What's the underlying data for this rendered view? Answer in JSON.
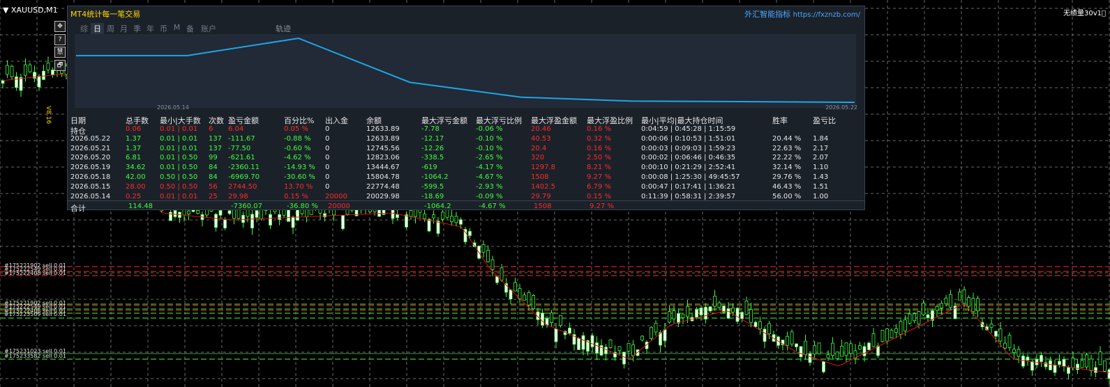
{
  "chart": {
    "symbol": "XAUUSD,M1",
    "right_label": "无绩量30v1⃝",
    "side_text": "V8.16",
    "order_labels": [
      "#175221902 sell 0.01",
      "#175222549 sell 0.01",
      "#175222408 sell 0.01",
      "#175221902 sell 0.01",
      "#175222549 sell 0.01",
      "#175222408 sell 0.01",
      "#175223509 sell 0.01",
      "#175231023 sell 0.01",
      "#175233582 sell 0.01"
    ]
  },
  "toolbar": {
    "icons": [
      "move-icon",
      "help-icon",
      "ai-icon",
      "window-icon"
    ],
    "glyphs": [
      "✥",
      "?",
      "慧",
      "🗗"
    ]
  },
  "panel": {
    "title": "MT4统计每一笔交易",
    "brand": "外汇智能指标",
    "brand_url": "https://fxznzb.com/",
    "tabs": [
      "综",
      "日",
      "周",
      "月",
      "季",
      "年",
      "币",
      "M",
      "备",
      "账户"
    ],
    "active_tab": 1,
    "track_tab": "轨迹",
    "plot": {
      "start_date": "2026.05.14",
      "end_date": "2026.05.22",
      "line_color": "#1fa5e8",
      "balance_series": [
        20029.98,
        20029.98,
        22774.48,
        15804.78,
        13444.67,
        12823.06,
        12745.56,
        12633.89
      ]
    },
    "headers": [
      "日期",
      "总手数",
      "最小|大手数",
      "次数",
      "盈亏金额",
      "百分比%",
      "出入金",
      "余额",
      "最大浮亏金额",
      "最大浮亏比例",
      "最大浮盈金额",
      "最大浮盈比例",
      "最小|平均|最大持仓时间",
      "胜率",
      "盈亏比"
    ],
    "rows": [
      {
        "c": [
          "持仓",
          "0.06",
          "0.01 | 0.01",
          "6",
          "6.04",
          "0.05 %",
          "0",
          "12633.89",
          "-7.78",
          "-0.06 %",
          "20.46",
          "0.16 %",
          "0:04:59 | 0:45:28 | 1:15:59",
          "",
          ""
        ],
        "k": [
          "w",
          "r",
          "r",
          "r",
          "r",
          "r",
          "w",
          "w",
          "g",
          "g",
          "r",
          "r",
          "w",
          "w",
          "w"
        ]
      },
      {
        "c": [
          "2026.05.22",
          "1.37",
          "0.01 | 0.01",
          "137",
          "-111.67",
          "-0.88 %",
          "0",
          "12633.89",
          "-12.17",
          "-0.10 %",
          "40.53",
          "0.32 %",
          "0:00:06 | 0:10:53 | 1:51:01",
          "20.44 %",
          "1.84"
        ],
        "k": [
          "w",
          "g",
          "g",
          "g",
          "g",
          "g",
          "w",
          "w",
          "g",
          "g",
          "r",
          "r",
          "w",
          "w",
          "w"
        ]
      },
      {
        "c": [
          "2026.05.21",
          "1.37",
          "0.01 | 0.01",
          "137",
          "-77.50",
          "-0.60 %",
          "0",
          "12745.56",
          "-12.26",
          "-0.10 %",
          "20.4",
          "0.16 %",
          "0:00:03 | 0:09:03 | 1:59:23",
          "22.63 %",
          "2.17"
        ],
        "k": [
          "w",
          "g",
          "g",
          "g",
          "g",
          "g",
          "w",
          "w",
          "g",
          "g",
          "r",
          "r",
          "w",
          "w",
          "w"
        ]
      },
      {
        "c": [
          "2026.05.20",
          "6.81",
          "0.01 | 0.50",
          "99",
          "-621.61",
          "-4.62 %",
          "0",
          "12823.06",
          "-338.5",
          "-2.65 %",
          "320",
          "2.50 %",
          "0:00:02 | 0:06:46 | 0:46:35",
          "22.22 %",
          "2.07"
        ],
        "k": [
          "w",
          "g",
          "g",
          "g",
          "g",
          "g",
          "w",
          "w",
          "g",
          "g",
          "r",
          "r",
          "w",
          "w",
          "w"
        ]
      },
      {
        "c": [
          "2026.05.19",
          "34.62",
          "0.01 | 0.50",
          "84",
          "-2360.11",
          "-14.93 %",
          "0",
          "13444.67",
          "-619",
          "-4.17 %",
          "1297.8",
          "8.21 %",
          "0:00:10 | 0:21:29 | 2:52:41",
          "32.14 %",
          "1.10"
        ],
        "k": [
          "w",
          "g",
          "g",
          "g",
          "g",
          "g",
          "w",
          "w",
          "g",
          "g",
          "r",
          "r",
          "w",
          "w",
          "w"
        ]
      },
      {
        "c": [
          "2026.05.18",
          "42.00",
          "0.50 | 0.50",
          "84",
          "-6969.70",
          "-30.60 %",
          "0",
          "15804.78",
          "-1064.2",
          "-4.67 %",
          "1508",
          "9.27 %",
          "0:00:08 | 1:25:30 | 49:45:57",
          "29.76 %",
          "1.43"
        ],
        "k": [
          "w",
          "g",
          "g",
          "g",
          "g",
          "g",
          "w",
          "w",
          "g",
          "g",
          "r",
          "r",
          "w",
          "w",
          "w"
        ]
      },
      {
        "c": [
          "2026.05.15",
          "28.00",
          "0.50 | 0.50",
          "56",
          "2744.50",
          "13.70 %",
          "0",
          "22774.48",
          "-599.5",
          "-2.93 %",
          "1402.5",
          "6.79 %",
          "0:00:47 | 0:17:41 | 1:36:21",
          "46.43 %",
          "1.51"
        ],
        "k": [
          "w",
          "r",
          "r",
          "r",
          "r",
          "r",
          "w",
          "w",
          "g",
          "g",
          "r",
          "r",
          "w",
          "w",
          "w"
        ]
      },
      {
        "c": [
          "2026.05.14",
          "0.25",
          "0.01 | 0.01",
          "25",
          "29.98",
          "0.15 %",
          "20000",
          "20029.98",
          "-18.69",
          "-0.09 %",
          "29.79",
          "0.15 %",
          "0:11:39 | 0:58:31 | 2:39:57",
          "56.00 %",
          "1.00"
        ],
        "k": [
          "w",
          "r",
          "r",
          "r",
          "r",
          "r",
          "r",
          "w",
          "g",
          "g",
          "r",
          "r",
          "w",
          "w",
          "w"
        ]
      }
    ],
    "total": {
      "label": "合计",
      "lots": "114.48",
      "pnl": "-7360.07",
      "pct": "-36.80 %",
      "deposit": "20000",
      "max_float_loss": "-1064.2",
      "max_float_loss_pct": "-4.67 %",
      "max_float_profit": "1508",
      "max_float_profit_pct": "9.27 %"
    }
  },
  "colors": {
    "red": "#ff2a2a",
    "green": "#3bff3b",
    "accent": "#ffd800",
    "brand": "#4aa8ff"
  }
}
